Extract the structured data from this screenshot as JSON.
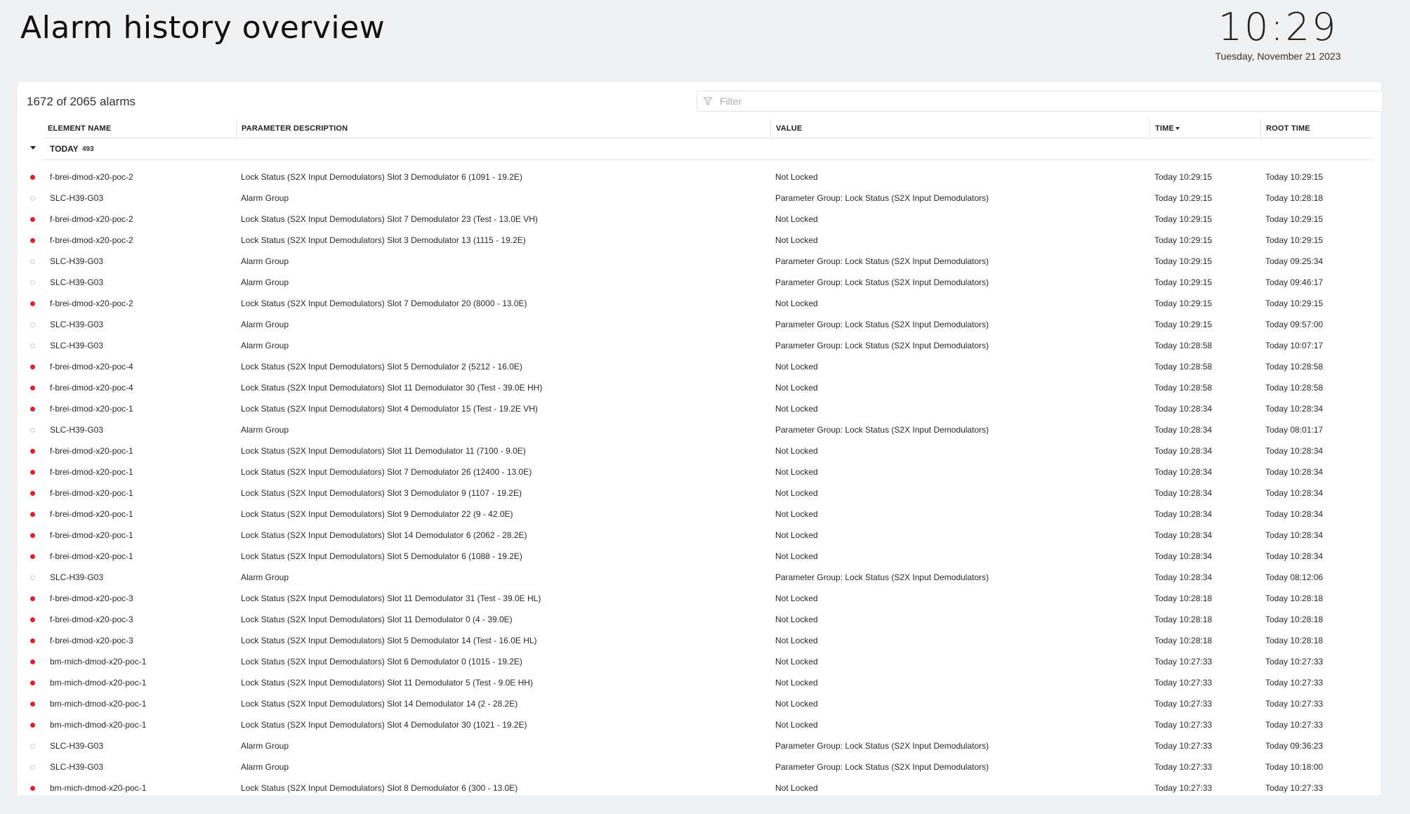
{
  "page": {
    "title": "Alarm history overview"
  },
  "clock": {
    "time": "10:29",
    "date": "Tuesday, November 21 2023"
  },
  "table": {
    "count_label": "1672 of 2065 alarms",
    "filter_placeholder": "Filter",
    "columns": {
      "element": "ELEMENT NAME",
      "parameter": "PARAMETER DESCRIPTION",
      "value": "VALUE",
      "time": "TIME",
      "root_time": "ROOT TIME"
    },
    "sort": {
      "column": "time",
      "direction": "descending"
    },
    "group": {
      "label": "TODAY",
      "count": "493",
      "expanded": true
    },
    "colors": {
      "active": "#e4202f",
      "inactive": "#c9cdd3"
    },
    "rows": [
      {
        "active": true,
        "element": "f-brei-dmod-x20-poc-2",
        "parameter": "Lock Status (S2X Input Demodulators) Slot 3 Demodulator 6 (1091 - 19.2E)",
        "value": "Not Locked",
        "time": "Today 10:29:15",
        "root_time": "Today 10:29:15"
      },
      {
        "active": false,
        "element": "SLC-H39-G03",
        "parameter": "Alarm Group",
        "value": "Parameter Group: Lock Status (S2X Input Demodulators)",
        "time": "Today 10:29:15",
        "root_time": "Today 10:28:18"
      },
      {
        "active": true,
        "element": "f-brei-dmod-x20-poc-2",
        "parameter": "Lock Status (S2X Input Demodulators) Slot 7 Demodulator 23 (Test - 13.0E VH)",
        "value": "Not Locked",
        "time": "Today 10:29:15",
        "root_time": "Today 10:29:15"
      },
      {
        "active": true,
        "element": "f-brei-dmod-x20-poc-2",
        "parameter": "Lock Status (S2X Input Demodulators) Slot 3 Demodulator 13 (1115 - 19.2E)",
        "value": "Not Locked",
        "time": "Today 10:29:15",
        "root_time": "Today 10:29:15"
      },
      {
        "active": false,
        "element": "SLC-H39-G03",
        "parameter": "Alarm Group",
        "value": "Parameter Group: Lock Status (S2X Input Demodulators)",
        "time": "Today 10:29:15",
        "root_time": "Today 09:25:34"
      },
      {
        "active": false,
        "element": "SLC-H39-G03",
        "parameter": "Alarm Group",
        "value": "Parameter Group: Lock Status (S2X Input Demodulators)",
        "time": "Today 10:29:15",
        "root_time": "Today 09:46:17"
      },
      {
        "active": true,
        "element": "f-brei-dmod-x20-poc-2",
        "parameter": "Lock Status (S2X Input Demodulators) Slot 7 Demodulator 20 (8000 - 13.0E)",
        "value": "Not Locked",
        "time": "Today 10:29:15",
        "root_time": "Today 10:29:15"
      },
      {
        "active": false,
        "element": "SLC-H39-G03",
        "parameter": "Alarm Group",
        "value": "Parameter Group: Lock Status (S2X Input Demodulators)",
        "time": "Today 10:29:15",
        "root_time": "Today 09:57:00"
      },
      {
        "active": false,
        "element": "SLC-H39-G03",
        "parameter": "Alarm Group",
        "value": "Parameter Group: Lock Status (S2X Input Demodulators)",
        "time": "Today 10:28:58",
        "root_time": "Today 10:07:17"
      },
      {
        "active": true,
        "element": "f-brei-dmod-x20-poc-4",
        "parameter": "Lock Status (S2X Input Demodulators) Slot 5 Demodulator 2 (5212 - 16.0E)",
        "value": "Not Locked",
        "time": "Today 10:28:58",
        "root_time": "Today 10:28:58"
      },
      {
        "active": true,
        "element": "f-brei-dmod-x20-poc-4",
        "parameter": "Lock Status (S2X Input Demodulators) Slot 11 Demodulator 30 (Test - 39.0E HH)",
        "value": "Not Locked",
        "time": "Today 10:28:58",
        "root_time": "Today 10:28:58"
      },
      {
        "active": true,
        "element": "f-brei-dmod-x20-poc-1",
        "parameter": "Lock Status (S2X Input Demodulators) Slot 4 Demodulator 15 (Test - 19.2E VH)",
        "value": "Not Locked",
        "time": "Today 10:28:34",
        "root_time": "Today 10:28:34"
      },
      {
        "active": false,
        "element": "SLC-H39-G03",
        "parameter": "Alarm Group",
        "value": "Parameter Group: Lock Status (S2X Input Demodulators)",
        "time": "Today 10:28:34",
        "root_time": "Today 08:01:17"
      },
      {
        "active": true,
        "element": "f-brei-dmod-x20-poc-1",
        "parameter": "Lock Status (S2X Input Demodulators) Slot 11 Demodulator 11 (7100 - 9.0E)",
        "value": "Not Locked",
        "time": "Today 10:28:34",
        "root_time": "Today 10:28:34"
      },
      {
        "active": true,
        "element": "f-brei-dmod-x20-poc-1",
        "parameter": "Lock Status (S2X Input Demodulators) Slot 7 Demodulator 26 (12400 - 13.0E)",
        "value": "Not Locked",
        "time": "Today 10:28:34",
        "root_time": "Today 10:28:34"
      },
      {
        "active": true,
        "element": "f-brei-dmod-x20-poc-1",
        "parameter": "Lock Status (S2X Input Demodulators) Slot 3 Demodulator 9 (1107 - 19.2E)",
        "value": "Not Locked",
        "time": "Today 10:28:34",
        "root_time": "Today 10:28:34"
      },
      {
        "active": true,
        "element": "f-brei-dmod-x20-poc-1",
        "parameter": "Lock Status (S2X Input Demodulators) Slot 9 Demodulator 22 (9 - 42.0E)",
        "value": "Not Locked",
        "time": "Today 10:28:34",
        "root_time": "Today 10:28:34"
      },
      {
        "active": true,
        "element": "f-brei-dmod-x20-poc-1",
        "parameter": "Lock Status (S2X Input Demodulators) Slot 14 Demodulator 6 (2062 - 28.2E)",
        "value": "Not Locked",
        "time": "Today 10:28:34",
        "root_time": "Today 10:28:34"
      },
      {
        "active": true,
        "element": "f-brei-dmod-x20-poc-1",
        "parameter": "Lock Status (S2X Input Demodulators) Slot 5 Demodulator 6 (1088 - 19.2E)",
        "value": "Not Locked",
        "time": "Today 10:28:34",
        "root_time": "Today 10:28:34"
      },
      {
        "active": false,
        "element": "SLC-H39-G03",
        "parameter": "Alarm Group",
        "value": "Parameter Group: Lock Status (S2X Input Demodulators)",
        "time": "Today 10:28:34",
        "root_time": "Today 08:12:06"
      },
      {
        "active": true,
        "element": "f-brei-dmod-x20-poc-3",
        "parameter": "Lock Status (S2X Input Demodulators) Slot 11 Demodulator 31 (Test - 39.0E HL)",
        "value": "Not Locked",
        "time": "Today 10:28:18",
        "root_time": "Today 10:28:18"
      },
      {
        "active": true,
        "element": "f-brei-dmod-x20-poc-3",
        "parameter": "Lock Status (S2X Input Demodulators) Slot 11 Demodulator 0 (4 - 39.0E)",
        "value": "Not Locked",
        "time": "Today 10:28:18",
        "root_time": "Today 10:28:18"
      },
      {
        "active": true,
        "element": "f-brei-dmod-x20-poc-3",
        "parameter": "Lock Status (S2X Input Demodulators) Slot 5 Demodulator 14 (Test - 16.0E HL)",
        "value": "Not Locked",
        "time": "Today 10:28:18",
        "root_time": "Today 10:28:18"
      },
      {
        "active": true,
        "element": "bm-mich-dmod-x20-poc-1",
        "parameter": "Lock Status (S2X Input Demodulators) Slot 6 Demodulator 0 (1015 - 19.2E)",
        "value": "Not Locked",
        "time": "Today 10:27:33",
        "root_time": "Today 10:27:33"
      },
      {
        "active": true,
        "element": "bm-mich-dmod-x20-poc-1",
        "parameter": "Lock Status (S2X Input Demodulators) Slot 11 Demodulator 5 (Test - 9.0E HH)",
        "value": "Not Locked",
        "time": "Today 10:27:33",
        "root_time": "Today 10:27:33"
      },
      {
        "active": true,
        "element": "bm-mich-dmod-x20-poc-1",
        "parameter": "Lock Status (S2X Input Demodulators) Slot 14 Demodulator 14 (2 - 28.2E)",
        "value": "Not Locked",
        "time": "Today 10:27:33",
        "root_time": "Today 10:27:33"
      },
      {
        "active": true,
        "element": "bm-mich-dmod-x20-poc-1",
        "parameter": "Lock Status (S2X Input Demodulators) Slot 4 Demodulator 30 (1021 - 19.2E)",
        "value": "Not Locked",
        "time": "Today 10:27:33",
        "root_time": "Today 10:27:33"
      },
      {
        "active": false,
        "element": "SLC-H39-G03",
        "parameter": "Alarm Group",
        "value": "Parameter Group: Lock Status (S2X Input Demodulators)",
        "time": "Today 10:27:33",
        "root_time": "Today 09:36:23"
      },
      {
        "active": false,
        "element": "SLC-H39-G03",
        "parameter": "Alarm Group",
        "value": "Parameter Group: Lock Status (S2X Input Demodulators)",
        "time": "Today 10:27:33",
        "root_time": "Today 10:18:00"
      },
      {
        "active": true,
        "element": "bm-mich-dmod-x20-poc-1",
        "parameter": "Lock Status (S2X Input Demodulators) Slot 8 Demodulator 6 (300 - 13.0E)",
        "value": "Not Locked",
        "time": "Today 10:27:33",
        "root_time": "Today 10:27:33"
      }
    ]
  }
}
